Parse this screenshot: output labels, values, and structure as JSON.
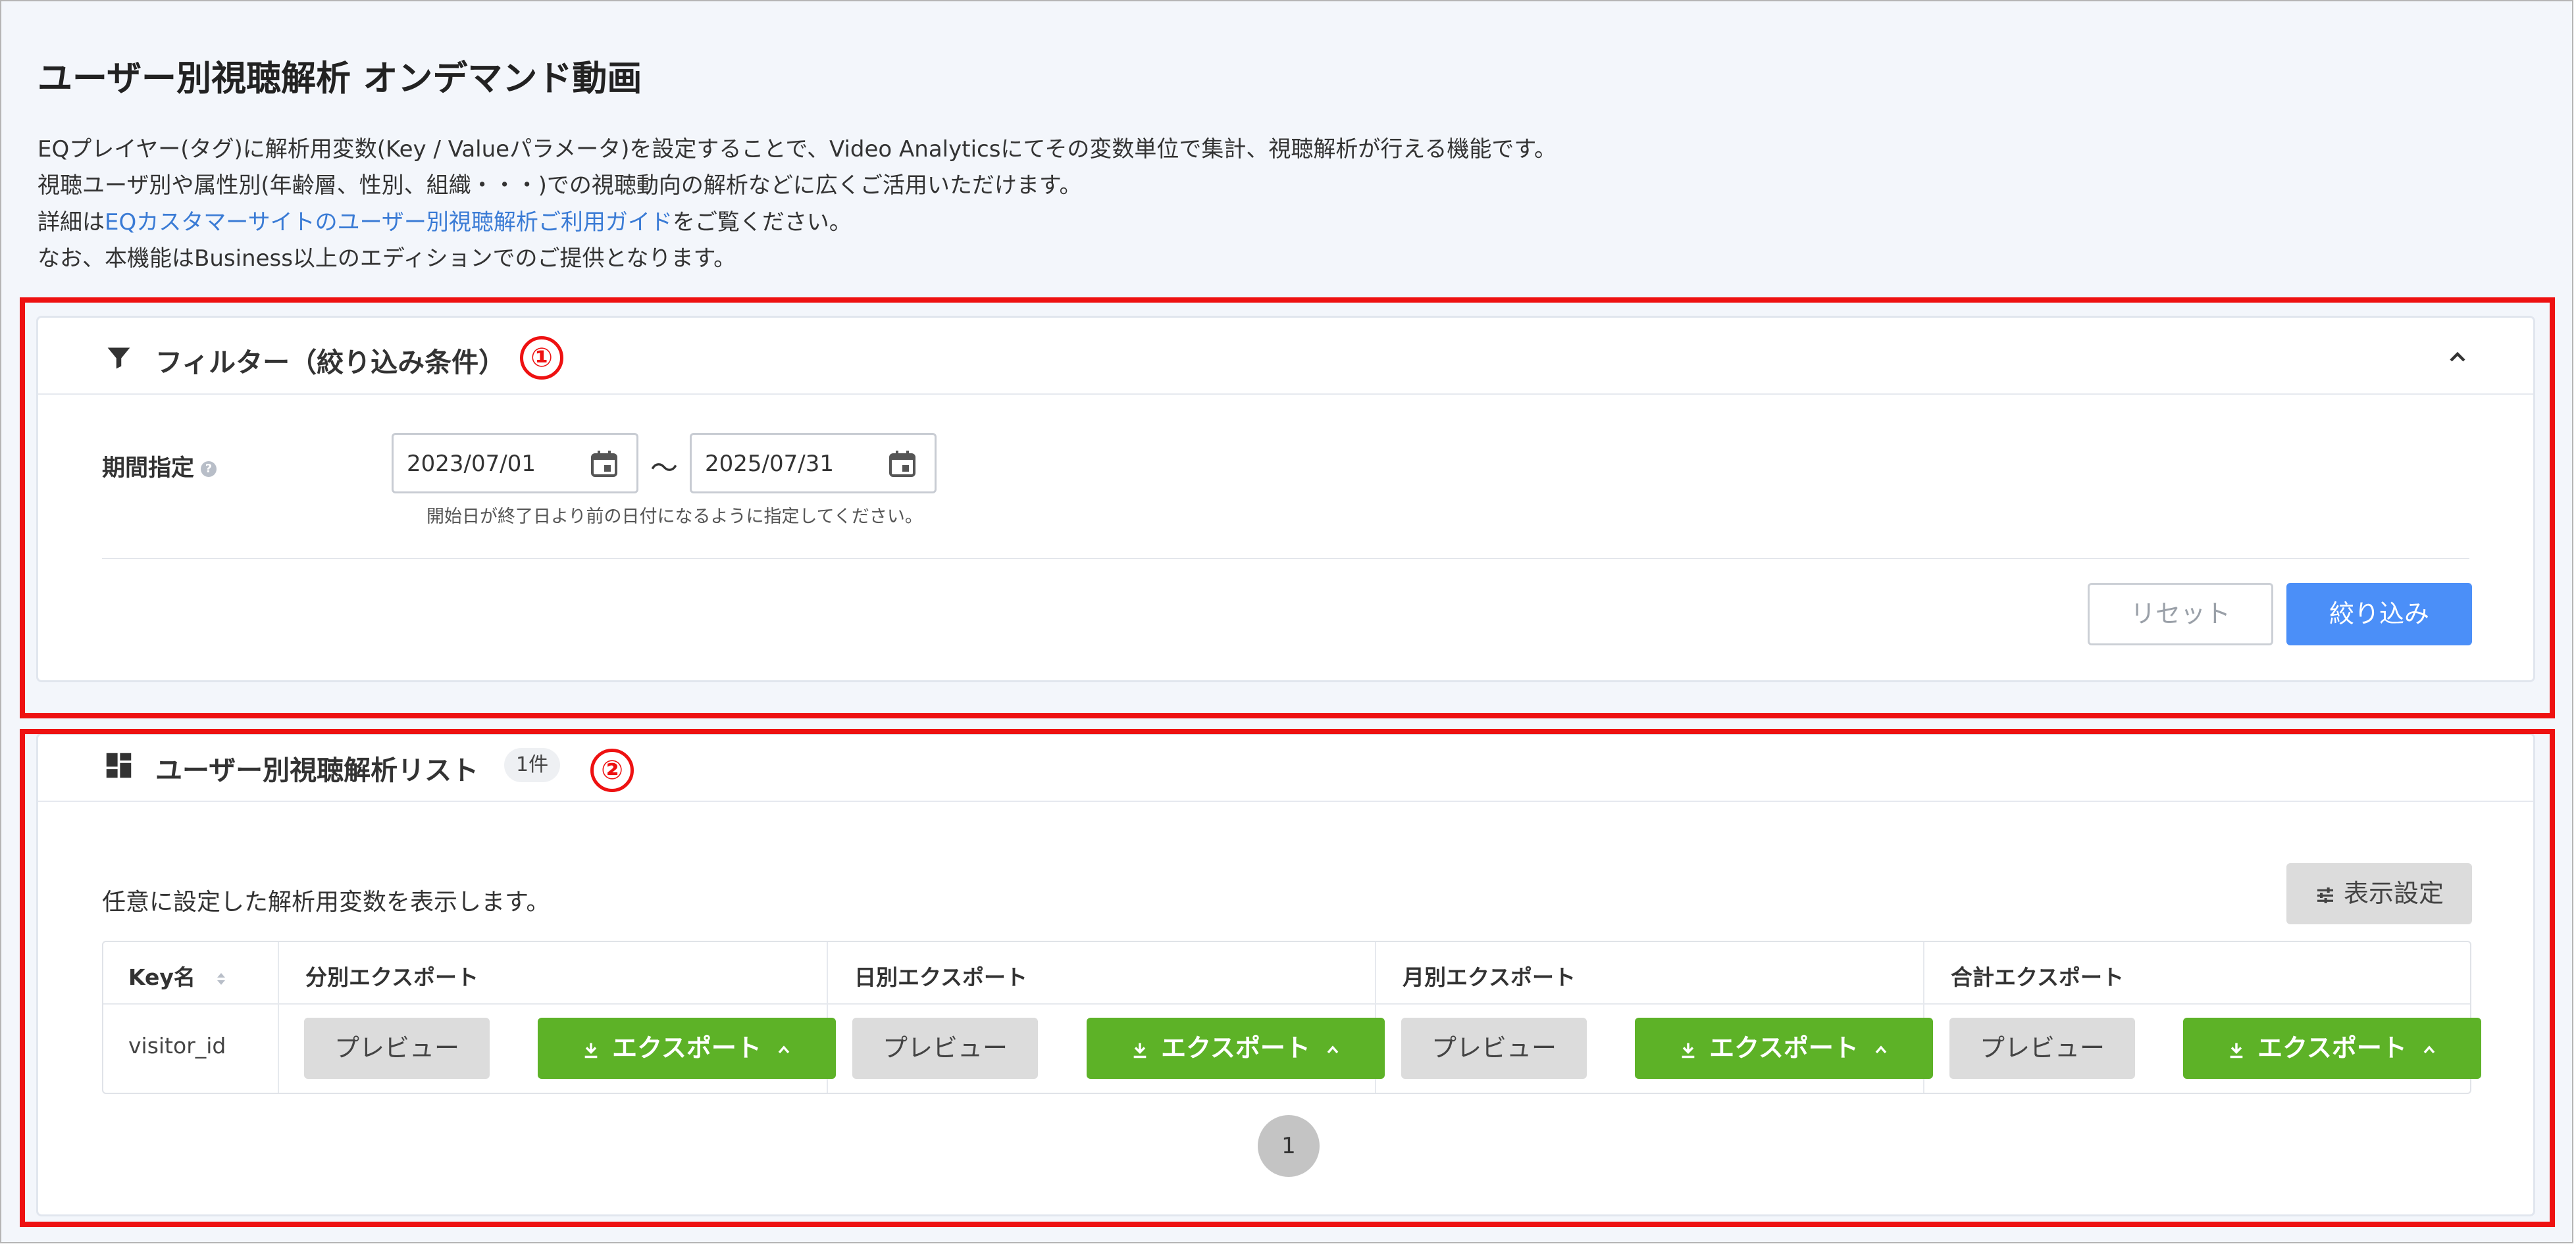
{
  "page": {
    "title": "ユーザー別視聴解析 オンデマンド動画",
    "desc_line1": "EQプレイヤー(タグ)に解析用変数(Key / Valueパラメータ)を設定することで、Video Analyticsにてその変数単位で集計、視聴解析が行える機能です。",
    "desc_line2": "視聴ユーザ別や属性別(年齢層、性別、組織・・・)での視聴動向の解析などに広くご活用いただけます。",
    "desc_line3_prefix": "詳細は",
    "desc_line3_link": "EQカスタマーサイトのユーザー別視聴解析ご利用ガイド",
    "desc_line3_suffix": "をご覧ください。",
    "desc_line4": "なお、本機能はBusiness以上のエディションでのご提供となります。"
  },
  "filter": {
    "title": "フィルター（絞り込み条件）",
    "badge": "①",
    "period_label": "期間指定",
    "help": "?",
    "start_date": "2023/07/01",
    "tilde": "〜",
    "end_date": "2025/07/31",
    "hint": "開始日が終了日より前の日付になるように指定してください。",
    "reset_label": "リセット",
    "apply_label": "絞り込み"
  },
  "list": {
    "title": "ユーザー別視聴解析リスト",
    "count": "1件",
    "badge": "②",
    "description": "任意に設定した解析用変数を表示します。",
    "display_settings_label": "表示設定",
    "columns": {
      "key": "Key名",
      "minute": "分別エクスポート",
      "daily": "日別エクスポート",
      "monthly": "月別エクスポート",
      "total": "合計エクスポート"
    },
    "rows": [
      {
        "key": "visitor_id"
      }
    ],
    "preview_label": "プレビュー",
    "export_label": "エクスポート",
    "page": "1"
  },
  "colors": {
    "accent_red": "#ee1111",
    "primary_blue": "#4b8ff8",
    "export_green": "#5db227"
  },
  "icons": [
    "filter-icon",
    "chevron-up-icon",
    "help-icon",
    "calendar-icon",
    "dashboard-icon",
    "sliders-icon",
    "sort-icon",
    "download-icon",
    "caret-up-icon"
  ]
}
